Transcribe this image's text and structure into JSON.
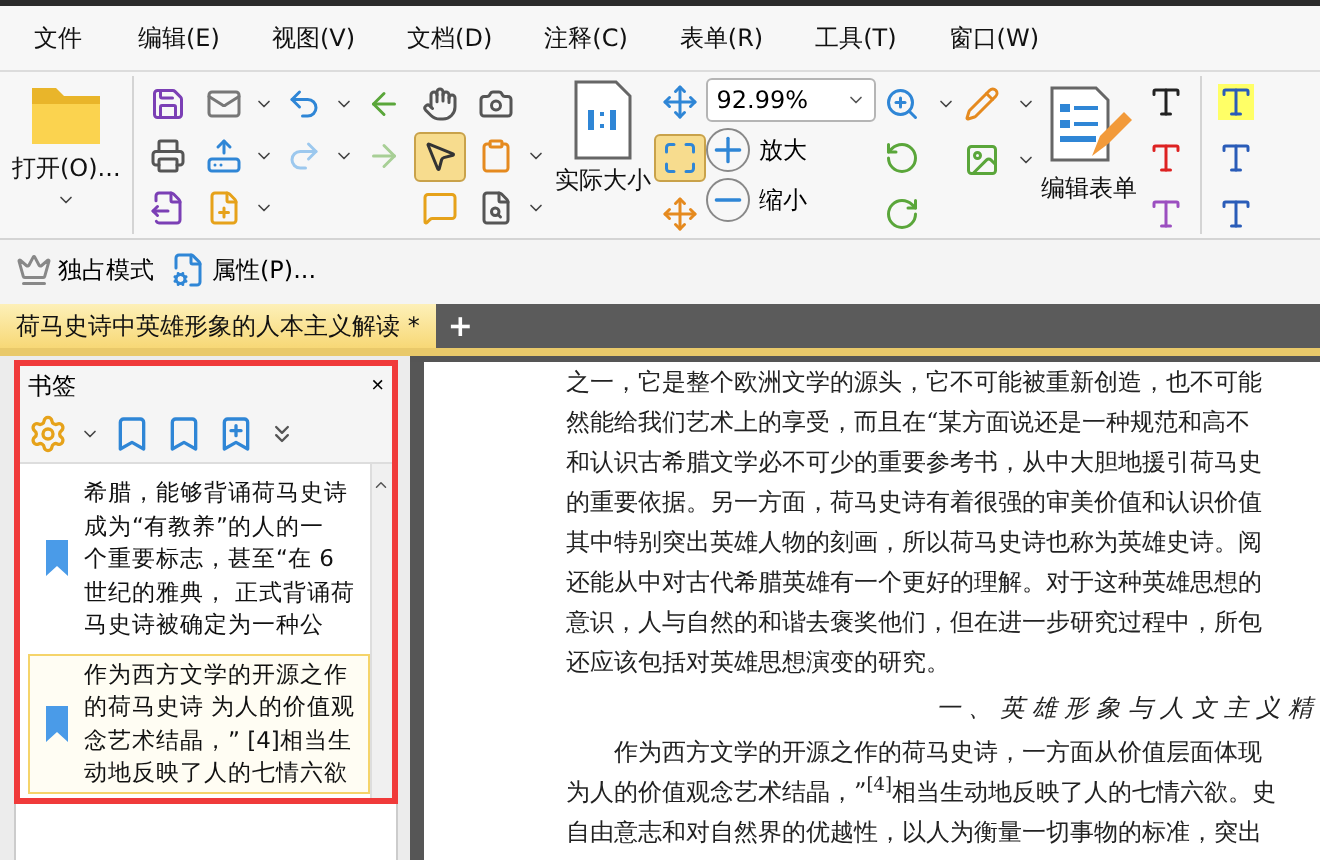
{
  "menu": [
    "文件",
    "编辑(E)",
    "视图(V)",
    "文档(D)",
    "注释(C)",
    "表单(R)",
    "工具(T)",
    "窗口(W)"
  ],
  "toolbar": {
    "open_label": "打开(O)...",
    "actual_size_label": "实际大小",
    "zoom_value": "92.99%",
    "zoom_in_label": "放大",
    "zoom_out_label": "缩小",
    "edit_form_label": "编辑表单",
    "text_select_tool": {
      "selected": true
    },
    "fit_view_tool": {
      "selected": true
    }
  },
  "secondary_toolbar": [
    "独占模式",
    "属性(P)..."
  ],
  "tabs": [
    {
      "label": "荷马史诗中英雄形象的人本主义解读 *",
      "selected": true
    }
  ],
  "new_tab": "+",
  "bookmarks": {
    "title": "书签",
    "close": "×",
    "items": [
      {
        "lines": [
          "希腊，能够背诵荷马史诗",
          "成为“有教养”的人的一",
          "个重要标志，甚至“在 6",
          "世纪的雅典， 正式背诵荷",
          "马史诗被确定为一种公"
        ],
        "selected": false
      },
      {
        "lines": [
          "作为西方文学的开源之作",
          "的荷马史诗 为人的价值观",
          "念艺术结晶，” [4]相当生",
          "动地反映了人的七情六欲"
        ],
        "selected": true
      }
    ]
  },
  "document": [
    {
      "kind": "text",
      "lines": [
        "之一，它是整个欧洲文学的源头，它不可能被重新创造，也不可能",
        "然能给我们艺术上的享受，而且在“某方面说还是一种规范和高不",
        "和认识古希腊文学必不可少的重要参考书，从中大胆地援引荷马史",
        "的重要依据。另一方面，荷马史诗有着很强的审美价值和认识价值",
        "其中特别突出英雄人物的刻画，所以荷马史诗也称为英雄史诗。阅",
        "还能从中对古代希腊英雄有一个更好的理解。对于这种英雄思想的",
        "意识，人与自然的和谐去褒奖他们，但在进一步研究过程中，所包",
        "还应该包括对英雄思想演变的研究。"
      ]
    },
    {
      "kind": "heading",
      "lines": [
        "一、英雄形象与人文主义精"
      ]
    },
    {
      "kind": "text",
      "lines": [
        "　　作为西方文学的开源之作的荷马史诗，一方面从价值层面体现",
        "为人的价值观念艺术结晶，”$^{[4]}$相当生动地反映了人的七情六欲。史",
        "自由意志和对自然界的优越性，以人为衡量一切事物的标准，突出"
      ]
    }
  ]
}
